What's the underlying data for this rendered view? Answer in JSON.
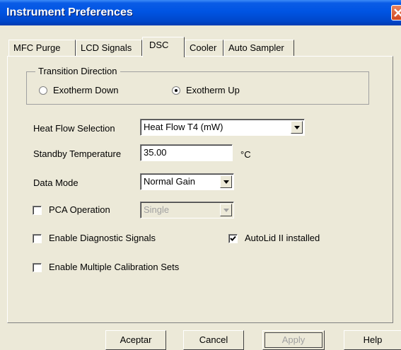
{
  "window": {
    "title": "Instrument Preferences"
  },
  "tabs": [
    {
      "label": "MFC Purge",
      "active": false
    },
    {
      "label": "LCD Signals",
      "active": false
    },
    {
      "label": "DSC",
      "active": true
    },
    {
      "label": "Cooler",
      "active": false
    },
    {
      "label": "Auto Sampler",
      "active": false
    }
  ],
  "transition": {
    "group_label": "Transition Direction",
    "options": [
      {
        "label": "Exotherm Down",
        "selected": false
      },
      {
        "label": "Exotherm Up",
        "selected": true
      }
    ]
  },
  "heat_flow": {
    "label": "Heat Flow Selection",
    "value": "Heat Flow T4 (mW)"
  },
  "standby": {
    "label": "Standby Temperature",
    "value": "35.00",
    "unit": "°C"
  },
  "data_mode": {
    "label": "Data Mode",
    "value": "Normal Gain"
  },
  "pca": {
    "label": "PCA Operation",
    "checked": false,
    "value": "Single",
    "enabled": false
  },
  "diagnostic": {
    "label": "Enable Diagnostic Signals",
    "checked": false
  },
  "autolid": {
    "label": "AutoLid II installed",
    "checked": true
  },
  "multi_cal": {
    "label": "Enable Multiple Calibration Sets",
    "checked": false
  },
  "buttons": {
    "ok": "Aceptar",
    "cancel": "Cancel",
    "apply": "Apply",
    "help": "Help"
  },
  "colors": {
    "titlebar": "#0054e3",
    "dialog_bg": "#ece9d8",
    "close_button": "#d2471f"
  }
}
